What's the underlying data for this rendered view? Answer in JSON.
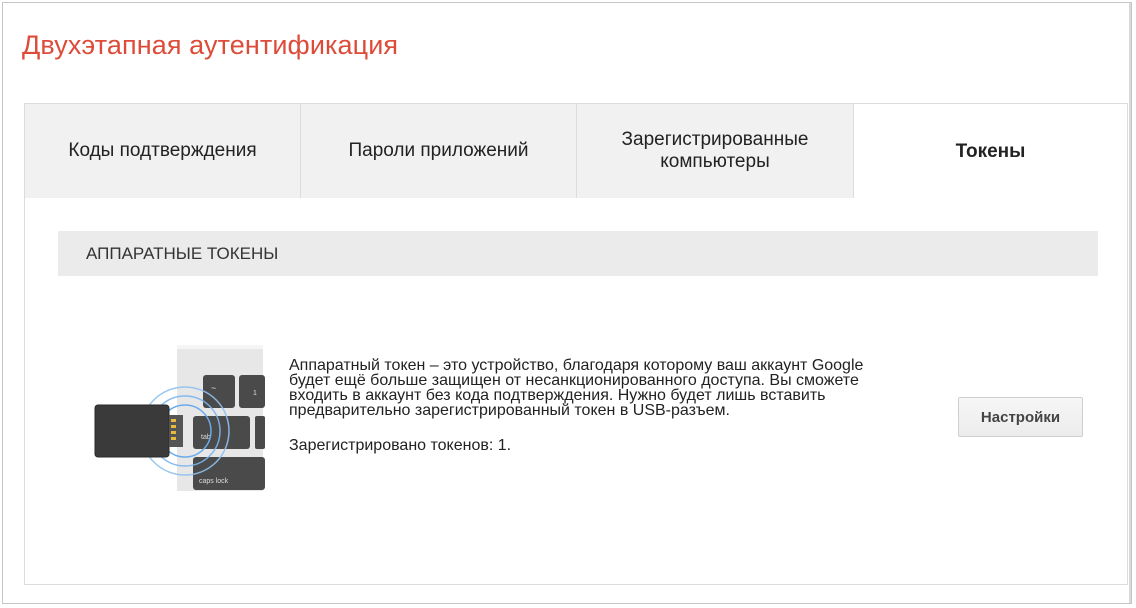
{
  "page": {
    "title": "Двухэтапная аутентификация"
  },
  "tabs": [
    {
      "label": "Коды подтверждения",
      "active": false
    },
    {
      "label": "Пароли приложений",
      "active": false
    },
    {
      "label": "Зарегистрированные компьютеры",
      "active": false
    },
    {
      "label": "Токены",
      "active": true
    }
  ],
  "section": {
    "header": "АППАРАТНЫЕ ТОКЕНЫ",
    "description": "Аппаратный токен – это устройство, благодаря которому ваш аккаунт Google будет ещё больше защищен от несанкционированного доступа. Вы сможете входить в аккаунт без кода подтверждения. Нужно будет лишь вставить предварительно зарегистрированный токен в USB-разъем.",
    "registered_count": "Зарегистрировано токенов: 1.",
    "settings_button": "Настройки",
    "illustration": {
      "key_tilde": "~",
      "key_one": "1",
      "key_tab": "tab",
      "key_caps": "caps lock"
    }
  },
  "colors": {
    "title": "#dd4b39",
    "tab_bg": "#f1f1f1",
    "section_header_bg": "#ebebeb",
    "border": "#dcdcdc"
  },
  "icons": [
    "usb-token-keyboard-illustration"
  ]
}
